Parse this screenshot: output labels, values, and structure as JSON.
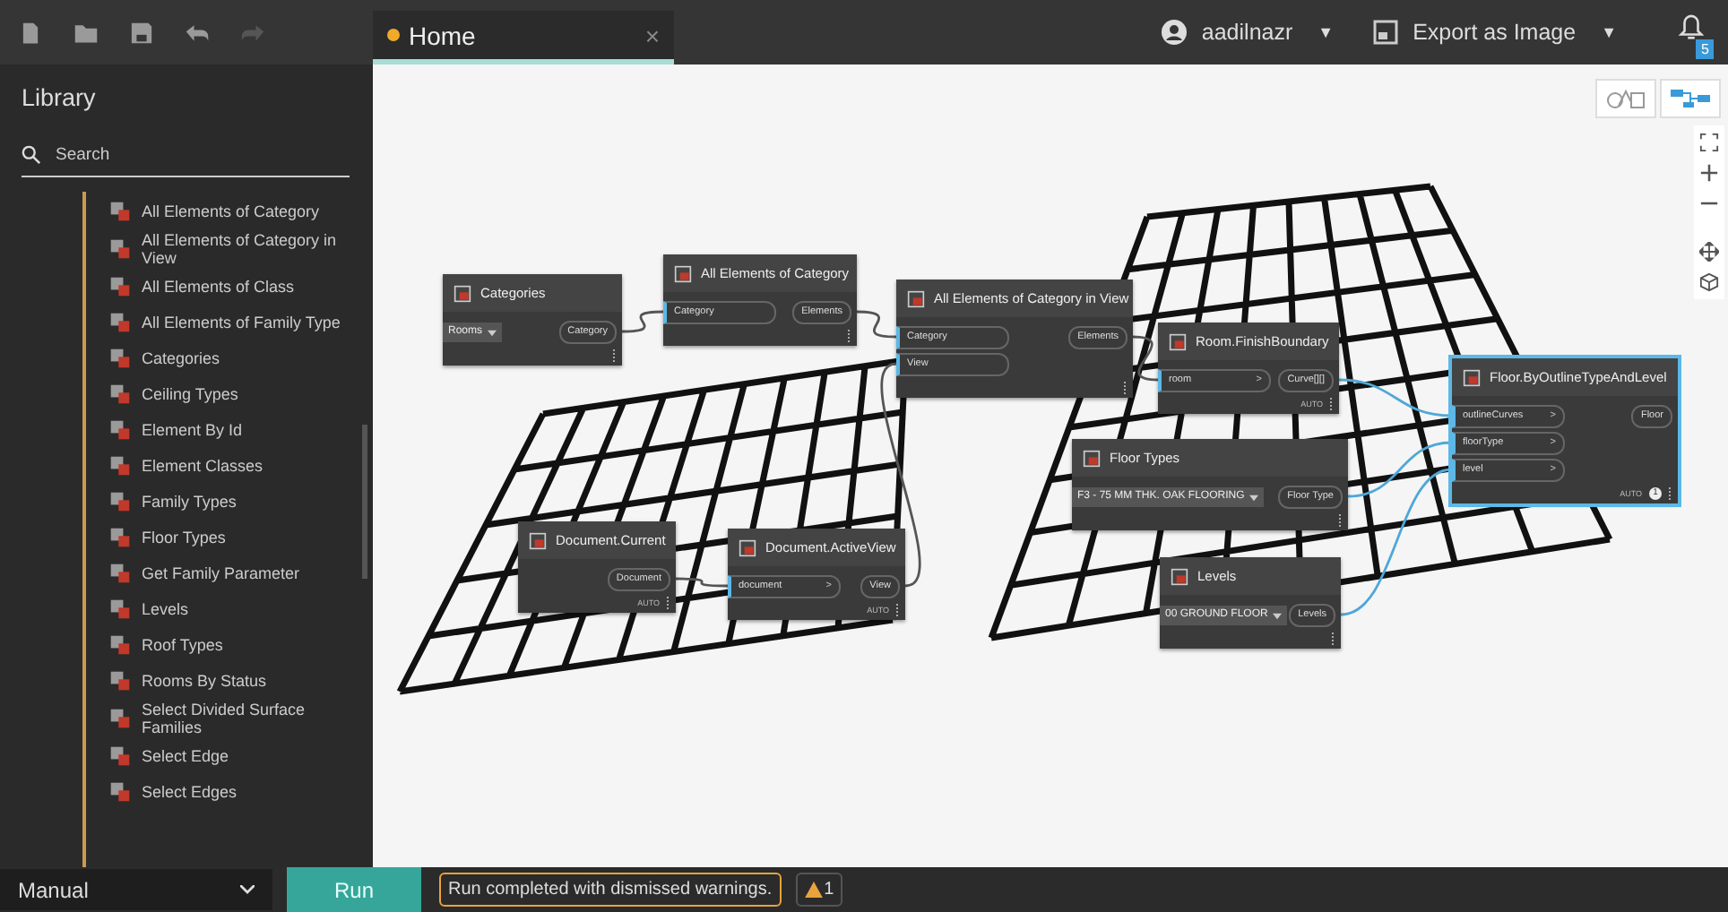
{
  "toolbar": {
    "buttons": [
      {
        "kind": "new",
        "disabled": false
      },
      {
        "kind": "open",
        "disabled": false
      },
      {
        "kind": "save",
        "disabled": false
      },
      {
        "kind": "undo",
        "disabled": false
      },
      {
        "kind": "redo",
        "disabled": true
      }
    ]
  },
  "tabs": [
    {
      "label": "Home",
      "selected": true,
      "modified": true,
      "close": "×"
    }
  ],
  "user": {
    "name": "aadilnazr",
    "caret": "▼"
  },
  "export": {
    "label": "Export as Image",
    "caret": "▼"
  },
  "notifications": {
    "count": "5"
  },
  "library": {
    "title": "Library",
    "search": {
      "placeholder": "Search"
    },
    "items": [
      {
        "label": "All Elements of Category"
      },
      {
        "label": "All Elements of Category in View"
      },
      {
        "label": "All Elements of Class"
      },
      {
        "label": "All Elements of Family Type"
      },
      {
        "label": "Categories"
      },
      {
        "label": "Ceiling Types"
      },
      {
        "label": "Element By Id"
      },
      {
        "label": "Element Classes"
      },
      {
        "label": "Family Types"
      },
      {
        "label": "Floor Types"
      },
      {
        "label": "Get Family Parameter"
      },
      {
        "label": "Levels"
      },
      {
        "label": "Roof Types"
      },
      {
        "label": "Rooms By Status"
      },
      {
        "label": "Select Divided Surface Families"
      },
      {
        "label": "Select Edge"
      },
      {
        "label": "Select Edges"
      }
    ]
  },
  "view_toggle": [
    {
      "kind": "geometry",
      "selected": false
    },
    {
      "kind": "graph",
      "selected": true
    }
  ],
  "nodes": [
    {
      "title": "Categories",
      "selected": false,
      "dropdown": "Rooms",
      "outputs": [
        "Category"
      ]
    },
    {
      "title": "All Elements of Category",
      "selected": false,
      "inputs": [
        {
          "label": "Category"
        }
      ],
      "outputs": [
        "Elements"
      ]
    },
    {
      "title": "All Elements of Category in View",
      "selected": false,
      "inputs": [
        {
          "label": "Category"
        },
        {
          "label": "View"
        }
      ],
      "outputs": [
        "Elements"
      ]
    },
    {
      "title": "Room.FinishBoundary",
      "selected": false,
      "inputs": [
        {
          "label": "room",
          "arrow": ">"
        }
      ],
      "outputs": [
        "Curve[][]"
      ],
      "lacing": "AUTO"
    },
    {
      "title": "Floor.ByOutlineTypeAndLevel",
      "selected": true,
      "inputs": [
        {
          "label": "outlineCurves",
          "arrow": ">"
        },
        {
          "label": "floorType",
          "arrow": ">"
        },
        {
          "label": "level",
          "arrow": ">"
        }
      ],
      "outputs": [
        "Floor"
      ],
      "lacing": "AUTO",
      "info_count": "1"
    },
    {
      "title": "Floor Types",
      "selected": false,
      "dropdown": "F3 - 75 MM THK. OAK FLOORING",
      "outputs": [
        "Floor Type"
      ]
    },
    {
      "title": "Document.Current",
      "selected": false,
      "outputs": [
        "Document"
      ],
      "lacing": "AUTO"
    },
    {
      "title": "Document.ActiveView",
      "selected": false,
      "inputs": [
        {
          "label": "document",
          "arrow": ">"
        }
      ],
      "outputs": [
        "View"
      ],
      "lacing": "AUTO"
    },
    {
      "title": "Levels",
      "selected": false,
      "dropdown": "00 GROUND FLOOR",
      "outputs": [
        "Levels"
      ]
    }
  ],
  "bottom": {
    "run_mode": "Manual",
    "run_button": "Run",
    "status": "Run completed with dismissed warnings.",
    "warnings": "1"
  }
}
